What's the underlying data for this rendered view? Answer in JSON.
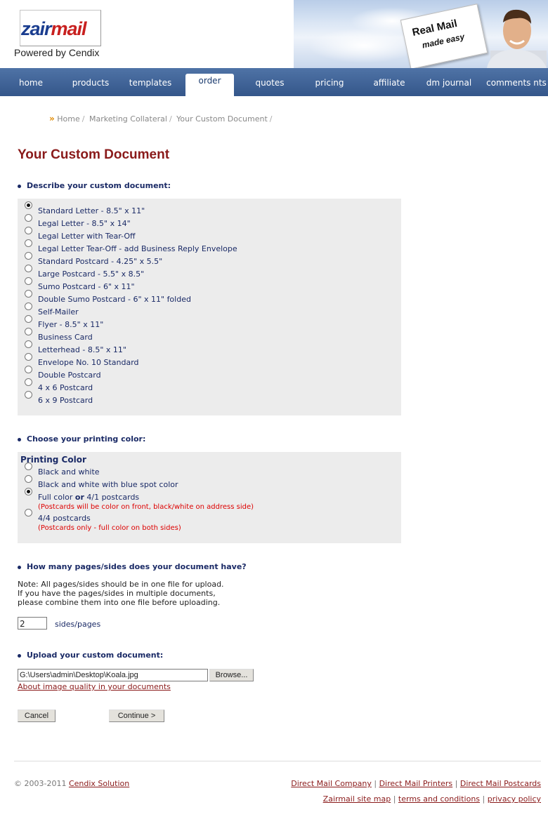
{
  "brand": {
    "logo_z": "zair",
    "logo_m": "mail",
    "sub": "Powered by Cendix"
  },
  "banner": {
    "line1": "Real Mail",
    "line2": "made easy"
  },
  "nav": [
    {
      "label": "home"
    },
    {
      "label": "products"
    },
    {
      "label": "templates"
    },
    {
      "label": "order",
      "active": true
    },
    {
      "label": "quotes"
    },
    {
      "label": "pricing"
    },
    {
      "label": "affiliate"
    },
    {
      "label": "dm journal"
    },
    {
      "label": "comments nts"
    }
  ],
  "breadcrumb": [
    "Home",
    "Marketing Collateral",
    "Your Custom Document"
  ],
  "page_title": "Your Custom Document",
  "section_describe": "Describe your custom document:",
  "doc_options": [
    {
      "label": "Standard Letter - 8.5\" x 11\"",
      "selected": true
    },
    {
      "label": "Legal Letter - 8.5\" x 14\""
    },
    {
      "label": "Legal Letter with Tear-Off"
    },
    {
      "label": "Legal Letter Tear-Off - add Business Reply Envelope"
    },
    {
      "label": "Standard Postcard - 4.25\" x 5.5\""
    },
    {
      "label": "Large Postcard - 5.5\" x 8.5\""
    },
    {
      "label": "Sumo Postcard - 6\" x 11\""
    },
    {
      "label": "Double Sumo Postcard - 6\" x 11\" folded"
    },
    {
      "label": "Self-Mailer"
    },
    {
      "label": "Flyer - 8.5\" x 11\""
    },
    {
      "label": "Business Card"
    },
    {
      "label": "Letterhead - 8.5\" x 11\""
    },
    {
      "label": "Envelope No. 10 Standard"
    },
    {
      "label": "Double Postcard"
    },
    {
      "label": "4 x 6 Postcard"
    },
    {
      "label": "6 x 9 Postcard"
    }
  ],
  "section_color": "Choose your printing color:",
  "printing_color_heading": "Printing Color",
  "color_options": {
    "bw": "Black and white",
    "bw_blue": "Black and white with blue spot color",
    "full_a": "Full color ",
    "full_or": "or",
    "full_b": " 4/1 postcards",
    "full_note": "(Postcards will be color on front, black/white on address side)",
    "four": "4/4 postcards",
    "four_note": "(Postcards only - full color on both sides)",
    "selected": "full"
  },
  "section_pages": "How many pages/sides does your document have?",
  "pages_note": [
    "Note: All pages/sides should be in one file for upload.",
    "If you have the pages/sides in multiple documents,",
    "please combine them into one file before uploading."
  ],
  "pages_value": "2",
  "pages_label": "sides/pages",
  "section_upload": "Upload your custom document:",
  "upload_value": "G:\\Users\\admin\\Desktop\\Koala.jpg",
  "browse_label": "Browse...",
  "image_quality_link": "About image quality in your documents",
  "cancel_label": "Cancel",
  "continue_label": "Continue  >",
  "footer": {
    "copyright": "© 2003-2011 ",
    "company": "Cendix Solution",
    "links_row1": [
      "Direct Mail Company",
      "Direct Mail Printers",
      "Direct Mail Postcards"
    ],
    "links_row2": [
      "Zairmail site map",
      "terms and conditions",
      "privacy policy"
    ]
  }
}
